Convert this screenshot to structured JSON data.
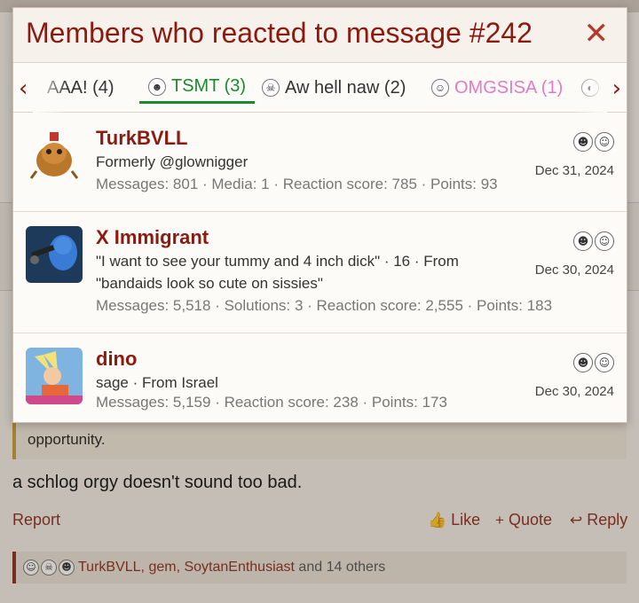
{
  "modal": {
    "title": "Members who reacted to message #242",
    "close_glyph": "✕"
  },
  "tabs": [
    {
      "label": "AAA! (4)",
      "icon": "none",
      "color": "#333333",
      "active": false
    },
    {
      "label": "TSMT (3)",
      "icon": "tsmt-face-icon",
      "color": "#1b8a2e",
      "active": true
    },
    {
      "label": "Aw hell naw (2)",
      "icon": "skull-icon",
      "color": "#333333",
      "active": false
    },
    {
      "label": "OMGSISA (1)",
      "icon": "omg-face-icon",
      "color": "#e57ac2",
      "active": false
    }
  ],
  "members": [
    {
      "name": "TurkBVLL",
      "title": "Formerly @glownigger",
      "stats": "Messages: 801 · Media: 1 · Reaction score: 785 · Points: 93",
      "date": "Dec 31, 2024",
      "avatar": "turkbvll-avatar"
    },
    {
      "name": "X Immigrant",
      "title": "\"I want to see your tummy and 4 inch dick\" · 16 · From \"bandaids look so cute on sissies\"",
      "stats": "Messages: 5,518 · Solutions: 3 · Reaction score: 2,555 · Points: 183",
      "date": "Dec 30, 2024",
      "avatar": "x-immigrant-avatar"
    },
    {
      "name": "dino",
      "title": "sage · From Israel",
      "stats": "Messages: 5,159 · Reaction score: 238 · Points: 173",
      "date": "Dec 30, 2024",
      "avatar": "dino-avatar"
    }
  ],
  "background": {
    "quote_text": "opportunity.",
    "post_text": "a schlog orgy doesn't sound too bad.",
    "report_label": "Report",
    "like_label": "Like",
    "quote_label": "Quote",
    "reply_label": "Reply",
    "reactions_names": "TurkBVLL, gem, SoytanEnthusiast",
    "reactions_rest": " and 14 others"
  },
  "colors": {
    "accent": "#8b1a10",
    "active_tab": "#1b8a2e",
    "omg_tab": "#e57ac2"
  }
}
